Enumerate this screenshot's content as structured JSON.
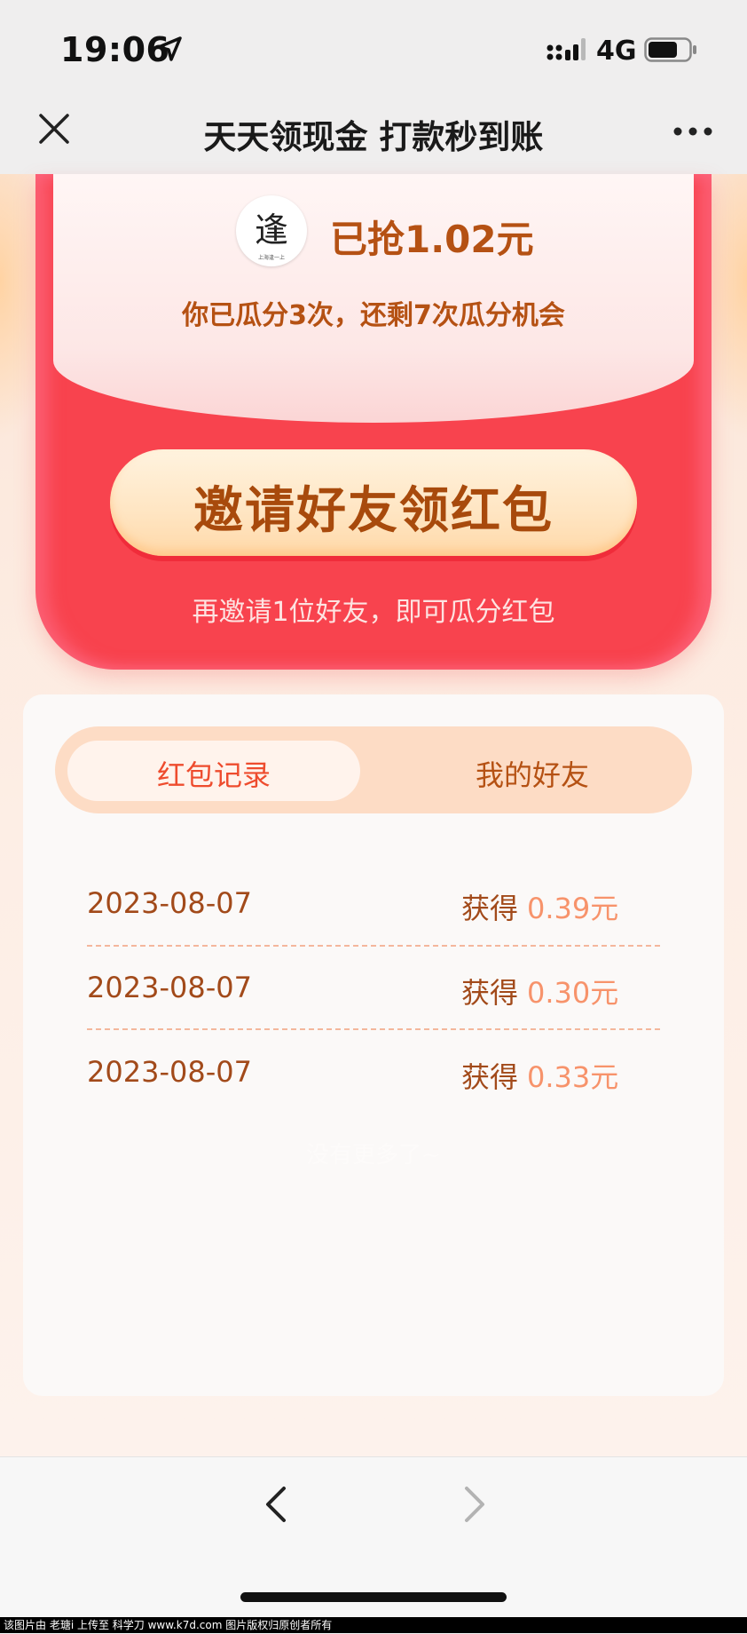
{
  "status_bar": {
    "time": "19:06",
    "network": "4G",
    "icons": [
      "location-arrow-icon",
      "signal-icon",
      "battery-icon"
    ]
  },
  "nav": {
    "title": "天天领现金 打款秒到账",
    "close_icon": "close-icon",
    "more_icon": "more-icon"
  },
  "hero": {
    "avatar_text": "逢",
    "avatar_caption": "上海逢一上",
    "grabbed": "已抢1.02元",
    "share_info": "你已瓜分3次，还剩7次瓜分机会",
    "invite_button": "邀请好友领红包",
    "invite_hint": "再邀请1位好友，即可瓜分红包"
  },
  "tabs": [
    {
      "label": "红包记录",
      "active": true
    },
    {
      "label": "我的好友",
      "active": false
    }
  ],
  "records": [
    {
      "date": "2023-08-07",
      "gain_label": "获得",
      "amount": "0.39元"
    },
    {
      "date": "2023-08-07",
      "gain_label": "获得",
      "amount": "0.30元"
    },
    {
      "date": "2023-08-07",
      "gain_label": "获得",
      "amount": "0.33元"
    }
  ],
  "no_more": "没有更多了~",
  "toolbar": {
    "back_icon": "chevron-left-icon",
    "forward_icon": "chevron-right-icon"
  },
  "watermark": "该图片由 老瑭i 上传至 科学刀 www.k7d.com 图片版权归原创者所有",
  "colors": {
    "red": "#f8434e",
    "brown": "#b55113",
    "orange_amount": "#f7936b",
    "tab_active_text": "#ee4c2e"
  }
}
